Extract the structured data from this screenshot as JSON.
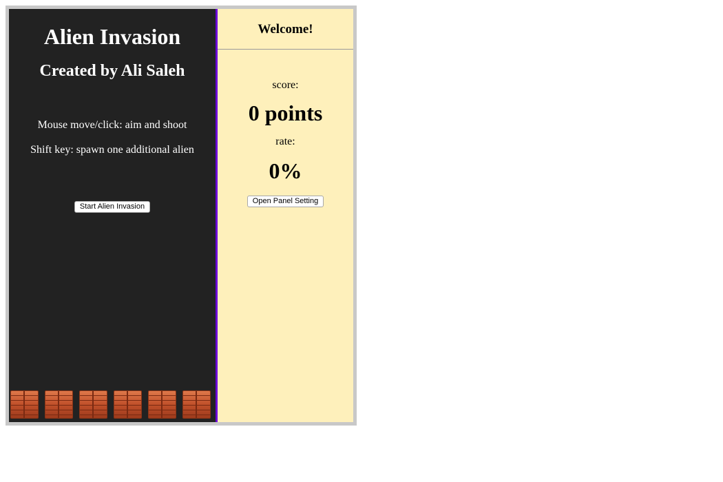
{
  "game": {
    "title": "Alien Invasion",
    "subtitle": "Created by Ali Saleh",
    "instructions": [
      "Mouse move/click: aim and shoot",
      "Shift key: spawn one additional alien"
    ],
    "start_button_label": "Start Alien Invasion",
    "brick_count": 6
  },
  "panel": {
    "welcome": "Welcome!",
    "score_label": "score:",
    "score_value": "0 points",
    "rate_label": "rate:",
    "rate_value": "0%",
    "settings_button_label": "Open Panel Setting"
  },
  "colors": {
    "game_background": "#222222",
    "panel_background": "#fef0bb",
    "divider": "#6a00d8",
    "frame_border": "#c8c8c8",
    "brick": "#c9552c"
  }
}
